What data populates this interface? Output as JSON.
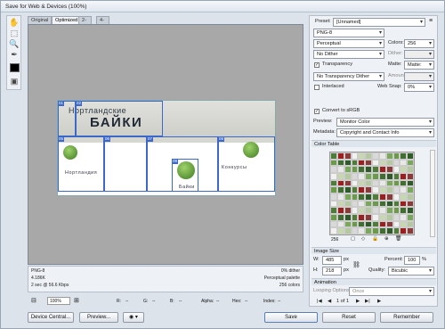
{
  "window": {
    "title": "Save for Web & Devices (100%)"
  },
  "tabs": [
    "Original",
    "Optimized",
    "2-Up",
    "4-Up"
  ],
  "tools": {
    "icons": [
      "hand-icon",
      "slice-select-icon",
      "zoom-icon",
      "eyedropper-icon",
      "eyedropper-color-icon",
      "toggle-slices-icon"
    ]
  },
  "preview": {
    "banner_line1": "Нортландские",
    "banner_line2": "БАЙКИ",
    "tile_labels": [
      "Нортландия",
      "Байки",
      "Конкурсы"
    ],
    "slices": [
      "01",
      "02",
      "05",
      "06",
      "07",
      "08",
      "09",
      "10"
    ]
  },
  "info_left": {
    "format": "PNG-8",
    "size": "4.186K",
    "time": "2 sec @ 56.6 Kbps"
  },
  "info_right": {
    "dither": "0% dither",
    "palette": "Perceptual palette",
    "colors": "256 colors"
  },
  "status": {
    "zoom": "100%",
    "r_label": "R:",
    "r_value": "--",
    "g_label": "G:",
    "g_value": "--",
    "b_label": "B:",
    "b_value": "--",
    "alpha_label": "Alpha:",
    "alpha_value": "--",
    "hex_label": "Hex:",
    "hex_value": "--",
    "index_label": "Index:",
    "index_value": "--"
  },
  "bottom_buttons": {
    "device_central": "Device Central...",
    "preview": "Preview...",
    "save": "Save",
    "reset": "Reset",
    "remember": "Remember"
  },
  "settings": {
    "preset_label": "Preset:",
    "preset_value": "[Unnamed]",
    "format": "PNG-8",
    "reduction": "Perceptual",
    "colors_label": "Colors:",
    "colors_value": "256",
    "dither_algo": "No Dither",
    "dither_label": "Dither:",
    "dither_value": "",
    "transparency_label": "Transparency",
    "transparency_checked": true,
    "matte_label": "Matte:",
    "trans_dither": "No Transparency Dither",
    "amount_label": "Amount:",
    "amount_value": "",
    "interlaced_label": "Interlaced",
    "interlaced_checked": false,
    "websnap_label": "Web Snap:",
    "websnap_value": "0%",
    "convert_srgb_label": "Convert to sRGB",
    "convert_srgb_checked": true,
    "preview_label": "Preview:",
    "preview_value": "Monitor Color",
    "metadata_label": "Metadata:",
    "metadata_value": "Copyright and Contact Info"
  },
  "color_table": {
    "title": "Color Table",
    "count": "256",
    "colors": [
      "#4e7d3a",
      "#e8e8e8",
      "#8b3a3a",
      "#6a9a4a",
      "#c7d7b0",
      "#2f5a2a",
      "#d9d9d9",
      "#9c1f1f",
      "#7aa85a",
      "#f1f1f1",
      "#3f6e30",
      "#b5c9a0"
    ]
  },
  "image_size": {
    "title": "Image Size",
    "w_label": "W:",
    "w_value": "485",
    "h_label": "H:",
    "h_value": "218",
    "unit": "px",
    "percent_label": "Percent:",
    "percent_value": "100",
    "percent_unit": "%",
    "quality_label": "Quality:",
    "quality_value": "Bicubic"
  },
  "animation": {
    "title": "Animation",
    "looping_label": "Looping Options:",
    "looping_value": "Once",
    "frame": "1 of 1"
  }
}
